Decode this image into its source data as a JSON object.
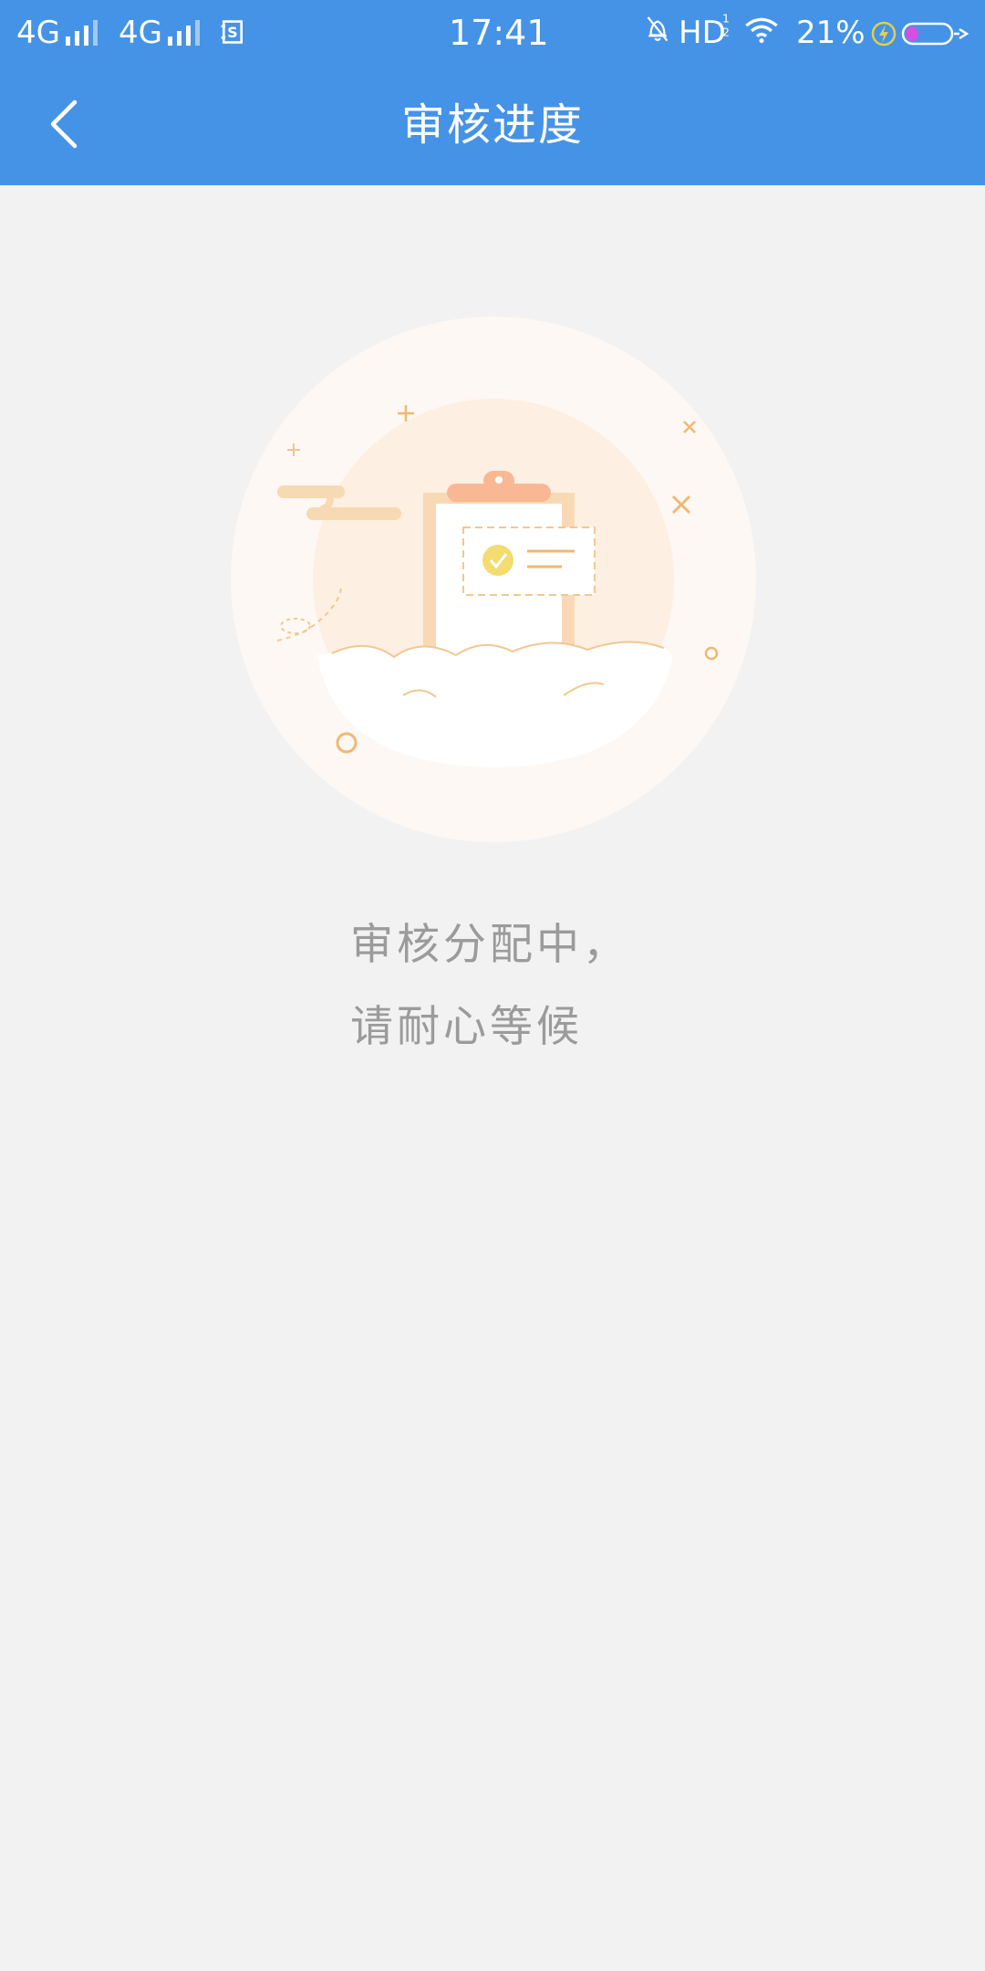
{
  "status_bar": {
    "network1": "4G",
    "network2": "4G",
    "time": "17:41",
    "hd_label": "HD",
    "battery": "21%"
  },
  "nav": {
    "title": "审核进度",
    "back_icon": "chevron-left-icon"
  },
  "message": {
    "line1": "审核分配中，",
    "line2": "请耐心等候"
  },
  "colors": {
    "primary": "#4593e6",
    "background": "#f2f2f2",
    "message_text": "#9b9b9b",
    "illustration_accent": "#f6c58e"
  }
}
